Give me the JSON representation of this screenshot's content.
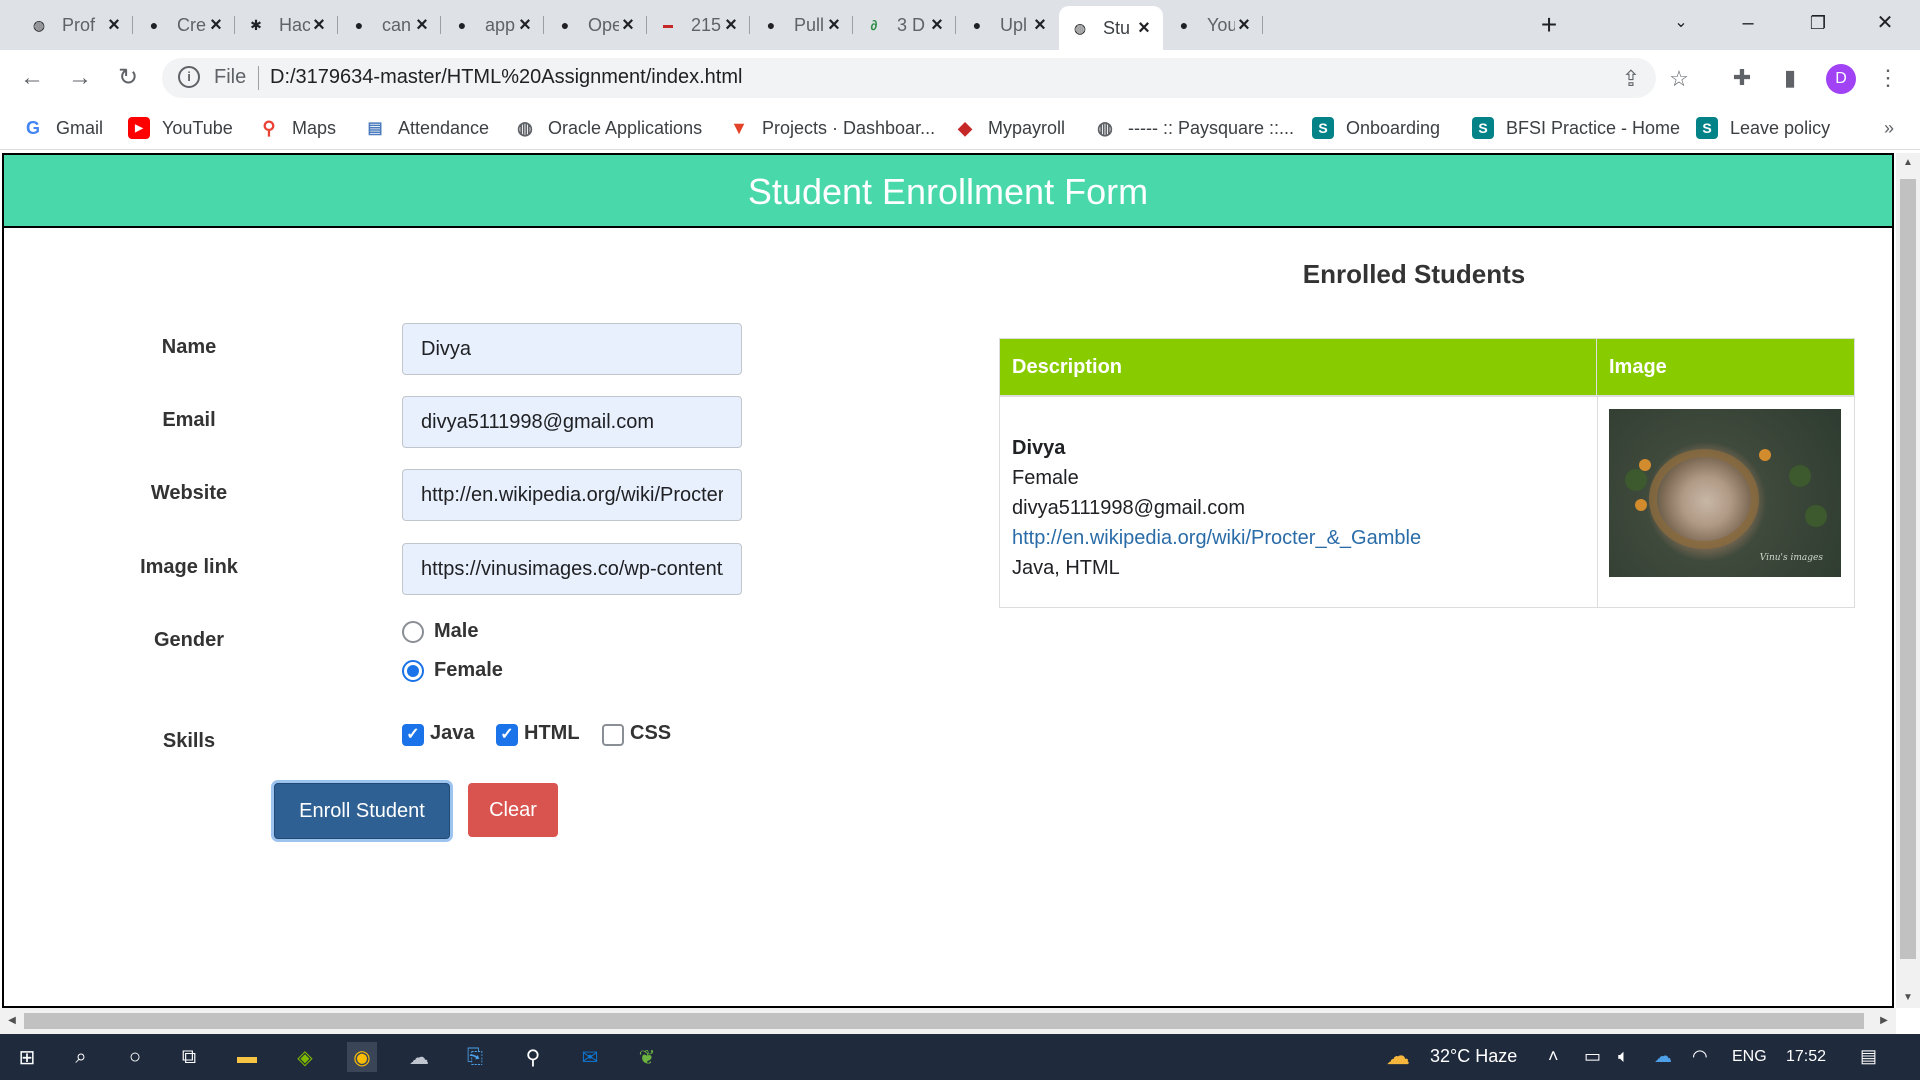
{
  "browser": {
    "tabs": [
      {
        "title": "Prof",
        "icon": "globe-icon"
      },
      {
        "title": "Cre",
        "icon": "github-icon"
      },
      {
        "title": "Hac",
        "icon": "hackerrank-icon"
      },
      {
        "title": "can",
        "icon": "github-icon"
      },
      {
        "title": "app",
        "icon": "github-icon"
      },
      {
        "title": "Ope",
        "icon": "github-icon"
      },
      {
        "title": "215",
        "icon": "books-icon"
      },
      {
        "title": "Pull",
        "icon": "github-icon"
      },
      {
        "title": "3 D",
        "icon": "gfg-icon"
      },
      {
        "title": "Upl",
        "icon": "github-icon"
      },
      {
        "title": "Stu",
        "icon": "globe-icon"
      },
      {
        "title": "You",
        "icon": "github-icon"
      }
    ],
    "active_tab_index": 10,
    "address": {
      "scheme_label": "File",
      "url": "D:/3179634-master/HTML%20Assignment/index.html"
    },
    "avatar_letter": "D",
    "bookmarks": [
      {
        "label": "Gmail",
        "icon": "google-icon",
        "color": "#4285f4"
      },
      {
        "label": "YouTube",
        "icon": "youtube-icon",
        "color": "#ff0000"
      },
      {
        "label": "Maps",
        "icon": "maps-icon",
        "color": "#34a853"
      },
      {
        "label": "Attendance",
        "icon": "attendance-icon",
        "color": "#4a7bbd"
      },
      {
        "label": "Oracle Applications",
        "icon": "globe-icon",
        "color": "#5f6368"
      },
      {
        "label": "Projects · Dashboar...",
        "icon": "gitlab-icon",
        "color": "#e24329"
      },
      {
        "label": "Mypayroll",
        "icon": "payroll-icon",
        "color": "#c62828"
      },
      {
        "label": "----- :: Paysquare ::...",
        "icon": "globe-icon",
        "color": "#5f6368"
      },
      {
        "label": "Onboarding",
        "icon": "sharepoint-icon",
        "color": "#038387"
      },
      {
        "label": "BFSI Practice - Home",
        "icon": "sharepoint-icon",
        "color": "#038387"
      },
      {
        "label": "Leave policy",
        "icon": "sharepoint-icon",
        "color": "#038387"
      }
    ]
  },
  "page": {
    "header_title": "Student Enrollment Form",
    "header_color": "#48d8aa",
    "form": {
      "name_label": "Name",
      "name_value": "Divya",
      "email_label": "Email",
      "email_value": "divya5111998@gmail.com",
      "website_label": "Website",
      "website_value": "http://en.wikipedia.org/wiki/Procter_&_Gamble",
      "image_label": "Image link",
      "image_value": "https://vinusimages.co/wp-content/",
      "gender_label": "Gender",
      "gender_options": [
        {
          "label": "Male",
          "selected": false
        },
        {
          "label": "Female",
          "selected": true
        }
      ],
      "skills_label": "Skills",
      "skills": [
        {
          "label": "Java",
          "checked": true
        },
        {
          "label": "HTML",
          "checked": true
        },
        {
          "label": "CSS",
          "checked": false
        }
      ],
      "enroll_button": "Enroll Student",
      "clear_button": "Clear"
    },
    "enrolled": {
      "title": "Enrolled Students",
      "columns": [
        "Description",
        "Image"
      ],
      "header_color": "#88cc00",
      "rows": [
        {
          "name": "Divya",
          "gender": "Female",
          "email": "divya5111998@gmail.com",
          "website": "http://en.wikipedia.org/wiki/Procter_&_Gamble",
          "skills": "Java, HTML",
          "image_watermark": "Vinu's images"
        }
      ]
    }
  },
  "taskbar": {
    "weather": "32°C  Haze",
    "language": "ENG",
    "time": "17:52"
  }
}
